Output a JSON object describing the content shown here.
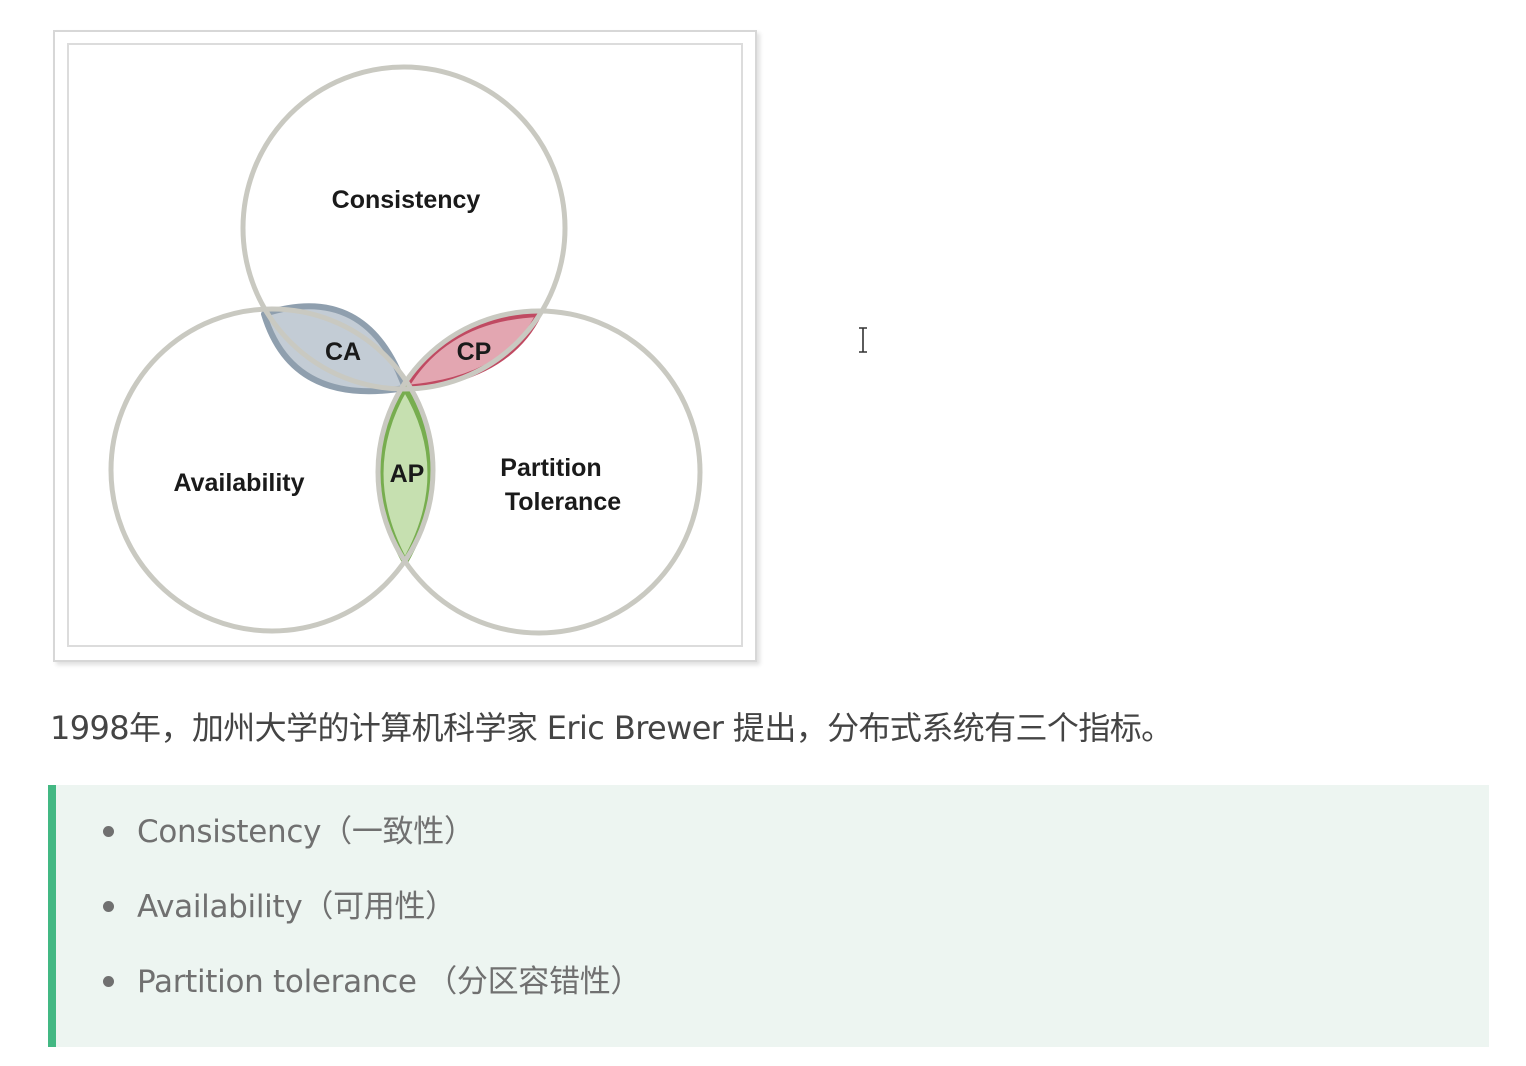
{
  "diagram": {
    "labels": {
      "consistency": "Consistency",
      "availability": "Availability",
      "partition_line1": "Partition",
      "partition_line2": "Tolerance",
      "ca": "CA",
      "cp": "CP",
      "ap": "AP"
    },
    "colors": {
      "circle_stroke": "#c9c9c1",
      "ca_fill": "#c3ccd5",
      "ca_stroke": "#8f9fae",
      "cp_fill": "#e3a6b1",
      "cp_stroke": "#c04a62",
      "ap_fill": "#c6e0b0",
      "ap_stroke": "#77ad4f"
    }
  },
  "paragraph": {
    "text": "1998年，加州大学的计算机科学家 Eric Brewer 提出，分布式系统有三个指标。"
  },
  "blockquote": {
    "accent_color": "#43b883",
    "background": "#edf5f1",
    "items": [
      {
        "label": "Consistency（一致性）"
      },
      {
        "label": "Availability（可用性）"
      },
      {
        "label": "Partition tolerance （分区容错性）"
      }
    ]
  }
}
